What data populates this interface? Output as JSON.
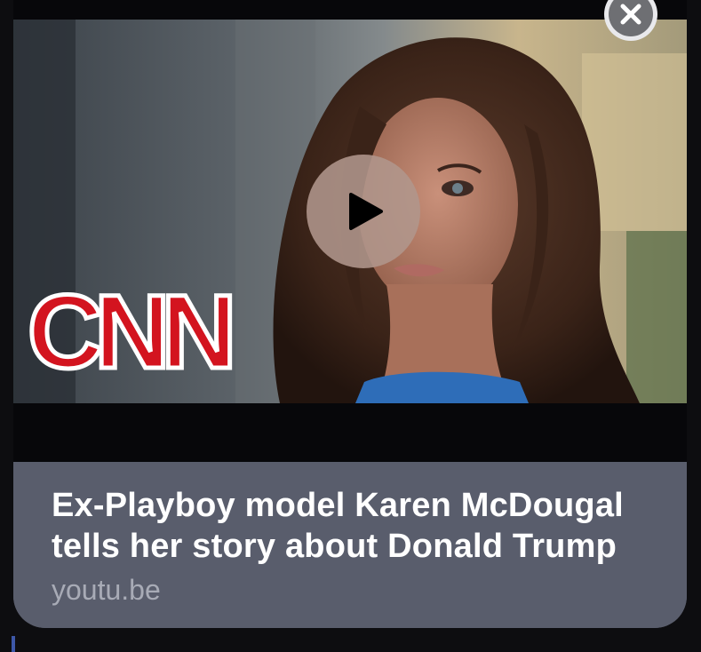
{
  "link_preview": {
    "title": "Ex-Playboy model Karen McDougal tells her story about Donald Trump",
    "domain": "youtu.be",
    "thumbnail": {
      "logo_text": "CNN",
      "logo_color": "#d3141f"
    }
  },
  "icons": {
    "play": "play-icon",
    "close": "close-icon"
  }
}
